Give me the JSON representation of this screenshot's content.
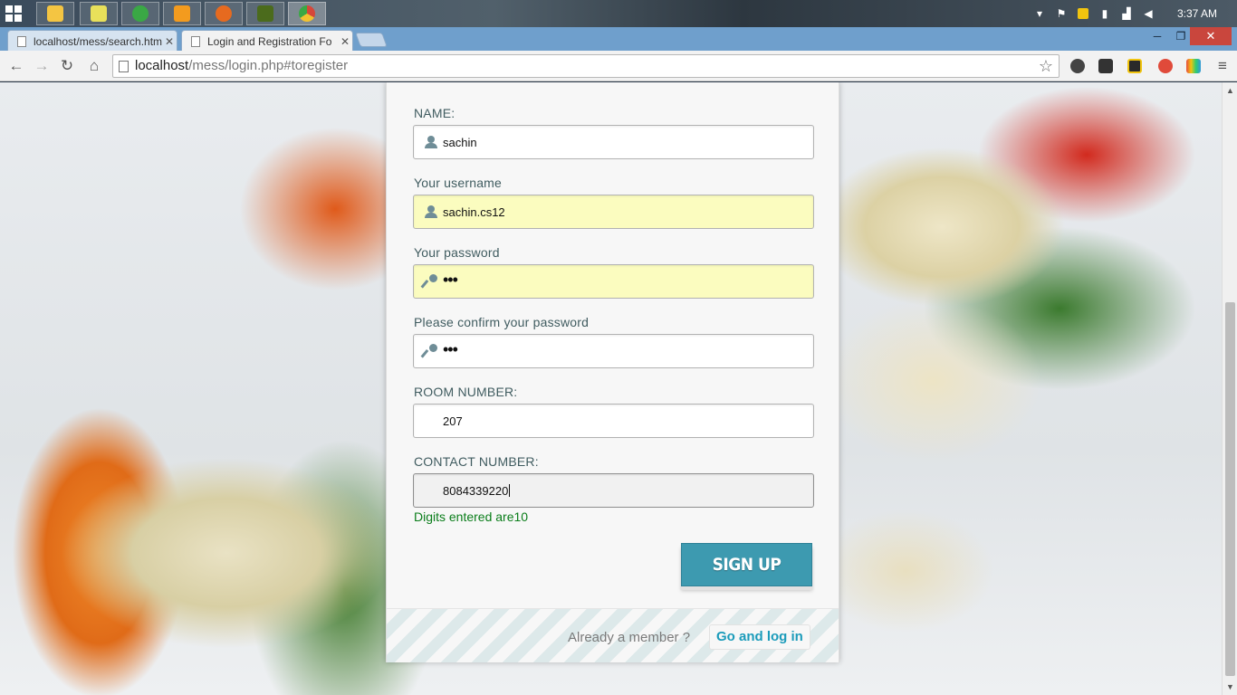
{
  "taskbar": {
    "apps": [
      {
        "name": "file-explorer",
        "color": "#f4c542"
      },
      {
        "name": "windows-explorer",
        "color": "#e8e05a"
      },
      {
        "name": "globe-app",
        "color": "#3aa845"
      },
      {
        "name": "media-player",
        "color": "#f39b1e"
      },
      {
        "name": "firefox",
        "color": "#e66a1f"
      },
      {
        "name": "dreamweaver",
        "color": "#4b6b1c"
      },
      {
        "name": "chrome",
        "color": "#d6473a"
      }
    ],
    "clock": "3:37 AM"
  },
  "browser": {
    "tabs": [
      {
        "title": "localhost/mess/search.htm",
        "active": false
      },
      {
        "title": "Login and Registration Fo",
        "active": true
      }
    ],
    "url_host": "localhost",
    "url_rest": "/mess/login.php#toregister"
  },
  "form": {
    "name_label": "NAME:",
    "name_value": "sachin",
    "username_label": "Your username",
    "username_value": "sachin.cs12",
    "password_label": "Your password",
    "password_value": "•••",
    "confirm_label": "Please confirm your password",
    "confirm_value": "•••",
    "room_label": "ROOM NUMBER:",
    "room_value": "207",
    "contact_label": "CONTACT NUMBER:",
    "contact_value": "8084339220",
    "digits_msg": "Digits entered are10",
    "signup_label": "SIGN UP",
    "already_text": "Already a member ?",
    "login_link": "Go and log in"
  }
}
